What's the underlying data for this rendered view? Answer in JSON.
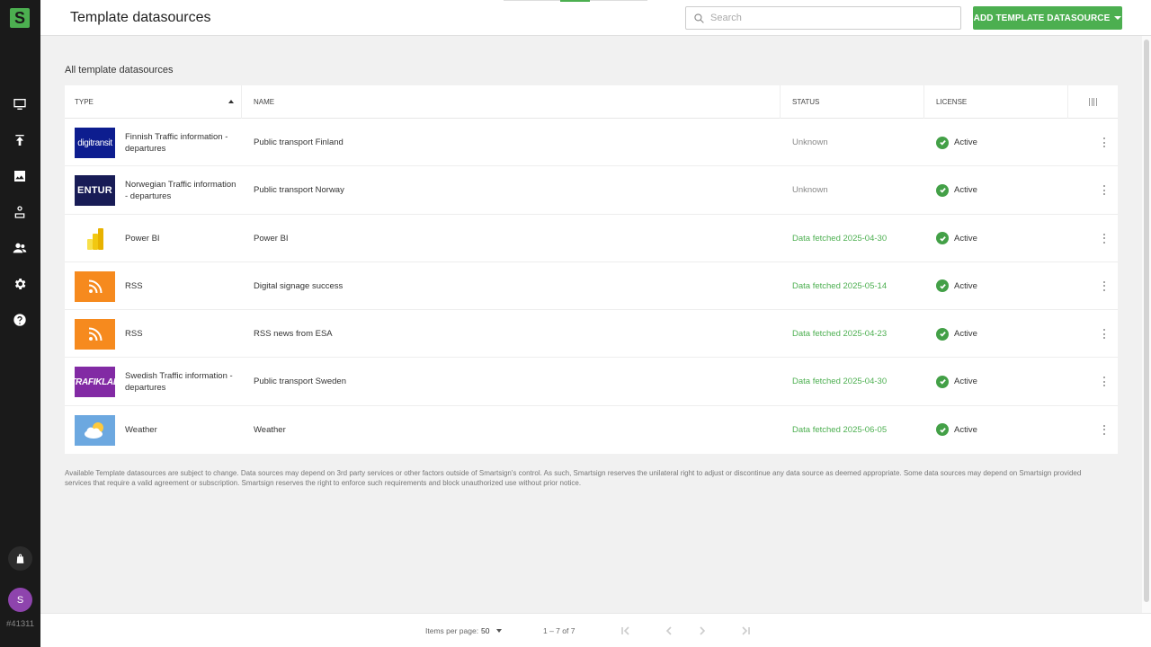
{
  "app": {
    "logo_letter": "S",
    "page_title": "Template datasources",
    "account_id": "#41311",
    "avatar_initial": "S",
    "brand_color": "#4caf50"
  },
  "sidebar": {
    "items": [
      {
        "icon": "monitor-icon"
      },
      {
        "icon": "upload-icon"
      },
      {
        "icon": "image-icon"
      },
      {
        "icon": "user-badge-icon"
      },
      {
        "icon": "people-icon"
      },
      {
        "icon": "gear-icon"
      },
      {
        "icon": "help-icon"
      }
    ]
  },
  "search": {
    "placeholder": "Search",
    "value": ""
  },
  "toolbar": {
    "add_label": "ADD TEMPLATE DATASOURCE"
  },
  "section": {
    "title": "All template datasources"
  },
  "table": {
    "columns": {
      "type": "TYPE",
      "name": "NAME",
      "status": "STATUS",
      "license": "LICENSE"
    },
    "rows": [
      {
        "thumb": "digitransit",
        "thumb_text": "digitransit",
        "type": "Finnish Traffic information - departures",
        "name": "Public transport Finland",
        "status": "Unknown",
        "status_ok": false,
        "license": "Active"
      },
      {
        "thumb": "entur",
        "thumb_text": "ENTUR",
        "type": "Norwegian Traffic information - departures",
        "name": "Public transport Norway",
        "status": "Unknown",
        "status_ok": false,
        "license": "Active"
      },
      {
        "thumb": "powerbi",
        "thumb_text": "",
        "type": "Power BI",
        "name": "Power BI",
        "status": "Data fetched 2025-04-30",
        "status_ok": true,
        "license": "Active"
      },
      {
        "thumb": "rss",
        "thumb_text": "",
        "type": "RSS",
        "name": "Digital signage success",
        "status": "Data fetched 2025-05-14",
        "status_ok": true,
        "license": "Active"
      },
      {
        "thumb": "rss",
        "thumb_text": "",
        "type": "RSS",
        "name": "RSS news from ESA",
        "status": "Data fetched 2025-04-23",
        "status_ok": true,
        "license": "Active"
      },
      {
        "thumb": "trafiklab",
        "thumb_text": "TRAFIKLAB",
        "type": "Swedish Traffic information - departures",
        "name": "Public transport Sweden",
        "status": "Data fetched 2025-04-30",
        "status_ok": true,
        "license": "Active"
      },
      {
        "thumb": "weather",
        "thumb_text": "",
        "type": "Weather",
        "name": "Weather",
        "status": "Data fetched 2025-06-05",
        "status_ok": true,
        "license": "Active"
      }
    ]
  },
  "disclaimer": "Available Template datasources are subject to change. Data sources may depend on 3rd party services or other factors outside of Smartsign's control. As such, Smartsign reserves the unilateral right to adjust or discontinue any data source as deemed appropriate. Some data sources may depend on Smartsign provided services that require a valid agreement or subscription. Smartsign reserves the right to enforce such requirements and block unauthorized use without prior notice.",
  "pagination": {
    "items_per_page_label": "Items per page:",
    "items_per_page": "50",
    "range": "1 – 7 of 7"
  }
}
